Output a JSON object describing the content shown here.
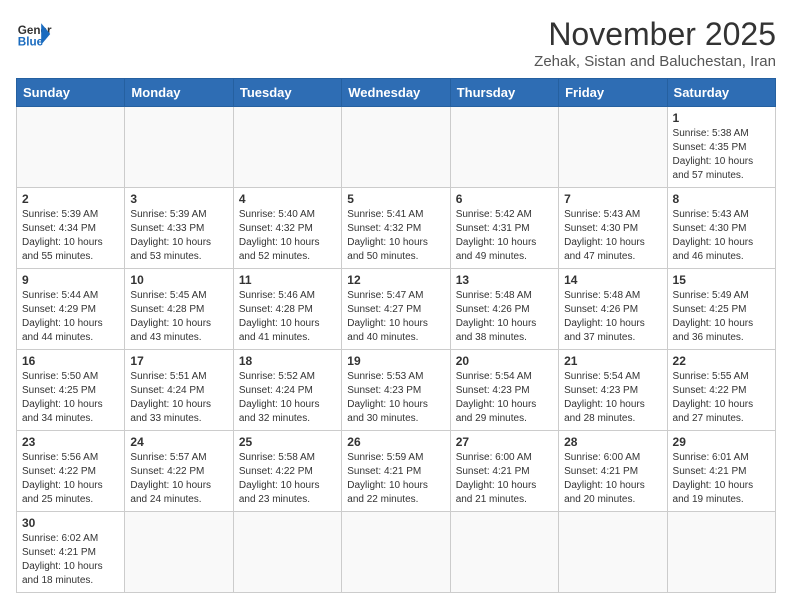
{
  "header": {
    "logo_general": "General",
    "logo_blue": "Blue",
    "month_title": "November 2025",
    "subtitle": "Zehak, Sistan and Baluchestan, Iran"
  },
  "days_of_week": [
    "Sunday",
    "Monday",
    "Tuesday",
    "Wednesday",
    "Thursday",
    "Friday",
    "Saturday"
  ],
  "weeks": [
    [
      {
        "day": "",
        "info": ""
      },
      {
        "day": "",
        "info": ""
      },
      {
        "day": "",
        "info": ""
      },
      {
        "day": "",
        "info": ""
      },
      {
        "day": "",
        "info": ""
      },
      {
        "day": "",
        "info": ""
      },
      {
        "day": "1",
        "info": "Sunrise: 5:38 AM\nSunset: 4:35 PM\nDaylight: 10 hours\nand 57 minutes."
      }
    ],
    [
      {
        "day": "2",
        "info": "Sunrise: 5:39 AM\nSunset: 4:34 PM\nDaylight: 10 hours\nand 55 minutes."
      },
      {
        "day": "3",
        "info": "Sunrise: 5:39 AM\nSunset: 4:33 PM\nDaylight: 10 hours\nand 53 minutes."
      },
      {
        "day": "4",
        "info": "Sunrise: 5:40 AM\nSunset: 4:32 PM\nDaylight: 10 hours\nand 52 minutes."
      },
      {
        "day": "5",
        "info": "Sunrise: 5:41 AM\nSunset: 4:32 PM\nDaylight: 10 hours\nand 50 minutes."
      },
      {
        "day": "6",
        "info": "Sunrise: 5:42 AM\nSunset: 4:31 PM\nDaylight: 10 hours\nand 49 minutes."
      },
      {
        "day": "7",
        "info": "Sunrise: 5:43 AM\nSunset: 4:30 PM\nDaylight: 10 hours\nand 47 minutes."
      },
      {
        "day": "8",
        "info": "Sunrise: 5:43 AM\nSunset: 4:30 PM\nDaylight: 10 hours\nand 46 minutes."
      }
    ],
    [
      {
        "day": "9",
        "info": "Sunrise: 5:44 AM\nSunset: 4:29 PM\nDaylight: 10 hours\nand 44 minutes."
      },
      {
        "day": "10",
        "info": "Sunrise: 5:45 AM\nSunset: 4:28 PM\nDaylight: 10 hours\nand 43 minutes."
      },
      {
        "day": "11",
        "info": "Sunrise: 5:46 AM\nSunset: 4:28 PM\nDaylight: 10 hours\nand 41 minutes."
      },
      {
        "day": "12",
        "info": "Sunrise: 5:47 AM\nSunset: 4:27 PM\nDaylight: 10 hours\nand 40 minutes."
      },
      {
        "day": "13",
        "info": "Sunrise: 5:48 AM\nSunset: 4:26 PM\nDaylight: 10 hours\nand 38 minutes."
      },
      {
        "day": "14",
        "info": "Sunrise: 5:48 AM\nSunset: 4:26 PM\nDaylight: 10 hours\nand 37 minutes."
      },
      {
        "day": "15",
        "info": "Sunrise: 5:49 AM\nSunset: 4:25 PM\nDaylight: 10 hours\nand 36 minutes."
      }
    ],
    [
      {
        "day": "16",
        "info": "Sunrise: 5:50 AM\nSunset: 4:25 PM\nDaylight: 10 hours\nand 34 minutes."
      },
      {
        "day": "17",
        "info": "Sunrise: 5:51 AM\nSunset: 4:24 PM\nDaylight: 10 hours\nand 33 minutes."
      },
      {
        "day": "18",
        "info": "Sunrise: 5:52 AM\nSunset: 4:24 PM\nDaylight: 10 hours\nand 32 minutes."
      },
      {
        "day": "19",
        "info": "Sunrise: 5:53 AM\nSunset: 4:23 PM\nDaylight: 10 hours\nand 30 minutes."
      },
      {
        "day": "20",
        "info": "Sunrise: 5:54 AM\nSunset: 4:23 PM\nDaylight: 10 hours\nand 29 minutes."
      },
      {
        "day": "21",
        "info": "Sunrise: 5:54 AM\nSunset: 4:23 PM\nDaylight: 10 hours\nand 28 minutes."
      },
      {
        "day": "22",
        "info": "Sunrise: 5:55 AM\nSunset: 4:22 PM\nDaylight: 10 hours\nand 27 minutes."
      }
    ],
    [
      {
        "day": "23",
        "info": "Sunrise: 5:56 AM\nSunset: 4:22 PM\nDaylight: 10 hours\nand 25 minutes."
      },
      {
        "day": "24",
        "info": "Sunrise: 5:57 AM\nSunset: 4:22 PM\nDaylight: 10 hours\nand 24 minutes."
      },
      {
        "day": "25",
        "info": "Sunrise: 5:58 AM\nSunset: 4:22 PM\nDaylight: 10 hours\nand 23 minutes."
      },
      {
        "day": "26",
        "info": "Sunrise: 5:59 AM\nSunset: 4:21 PM\nDaylight: 10 hours\nand 22 minutes."
      },
      {
        "day": "27",
        "info": "Sunrise: 6:00 AM\nSunset: 4:21 PM\nDaylight: 10 hours\nand 21 minutes."
      },
      {
        "day": "28",
        "info": "Sunrise: 6:00 AM\nSunset: 4:21 PM\nDaylight: 10 hours\nand 20 minutes."
      },
      {
        "day": "29",
        "info": "Sunrise: 6:01 AM\nSunset: 4:21 PM\nDaylight: 10 hours\nand 19 minutes."
      }
    ],
    [
      {
        "day": "30",
        "info": "Sunrise: 6:02 AM\nSunset: 4:21 PM\nDaylight: 10 hours\nand 18 minutes."
      },
      {
        "day": "",
        "info": ""
      },
      {
        "day": "",
        "info": ""
      },
      {
        "day": "",
        "info": ""
      },
      {
        "day": "",
        "info": ""
      },
      {
        "day": "",
        "info": ""
      },
      {
        "day": "",
        "info": ""
      }
    ]
  ]
}
